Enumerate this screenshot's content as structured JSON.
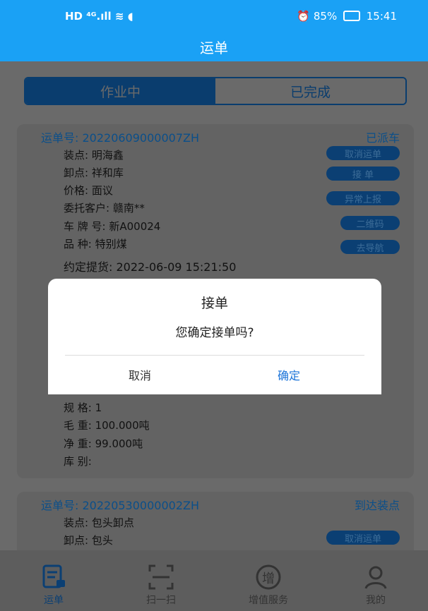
{
  "status_bar": {
    "left": "HD ⁴ᴳ.ıll ≋ ◖",
    "battery": "85%",
    "time": "15:41"
  },
  "header": {
    "title": "运单"
  },
  "tabs": [
    {
      "label": "作业中",
      "active": true
    },
    {
      "label": "已完成",
      "active": false
    }
  ],
  "orders": [
    {
      "order_no": "运单号:  20220609000007ZH",
      "status": "已派车",
      "fields": [
        "装点:  明海鑫",
        "卸点:  祥和库",
        "价格:  面议",
        "委托客户:  赣南**",
        "车  牌  号:  新A00024",
        "品        种:  特别煤",
        "约定提货:  2022-06-09 15:21:50",
        "规    格:  1",
        "毛    重:  100.000吨",
        "净    重:  99.000吨",
        "库    别:"
      ],
      "buttons": [
        "取消运单",
        "接        单",
        "异常上报",
        "二维码",
        "去导航"
      ]
    },
    {
      "order_no": "运单号:  20220530000002ZH",
      "status": "到达装点",
      "fields": [
        "装点:  包头卸点",
        "卸点:  包头"
      ],
      "buttons": [
        "取消运单"
      ]
    }
  ],
  "dialog": {
    "title": "接单",
    "message": "您确定接单吗?",
    "cancel": "取消",
    "confirm": "确定"
  },
  "bottom_nav": [
    {
      "label": "运单",
      "icon": "waybill-icon",
      "active": true
    },
    {
      "label": "扫一扫",
      "icon": "scan-icon",
      "active": false
    },
    {
      "label": "增值服务",
      "icon": "value-added-icon",
      "active": false
    },
    {
      "label": "我的",
      "icon": "profile-icon",
      "active": false
    }
  ],
  "colors": {
    "primary": "#1aa1f5",
    "dark_blue": "#0b3f73",
    "confirm": "#1a73d9"
  }
}
